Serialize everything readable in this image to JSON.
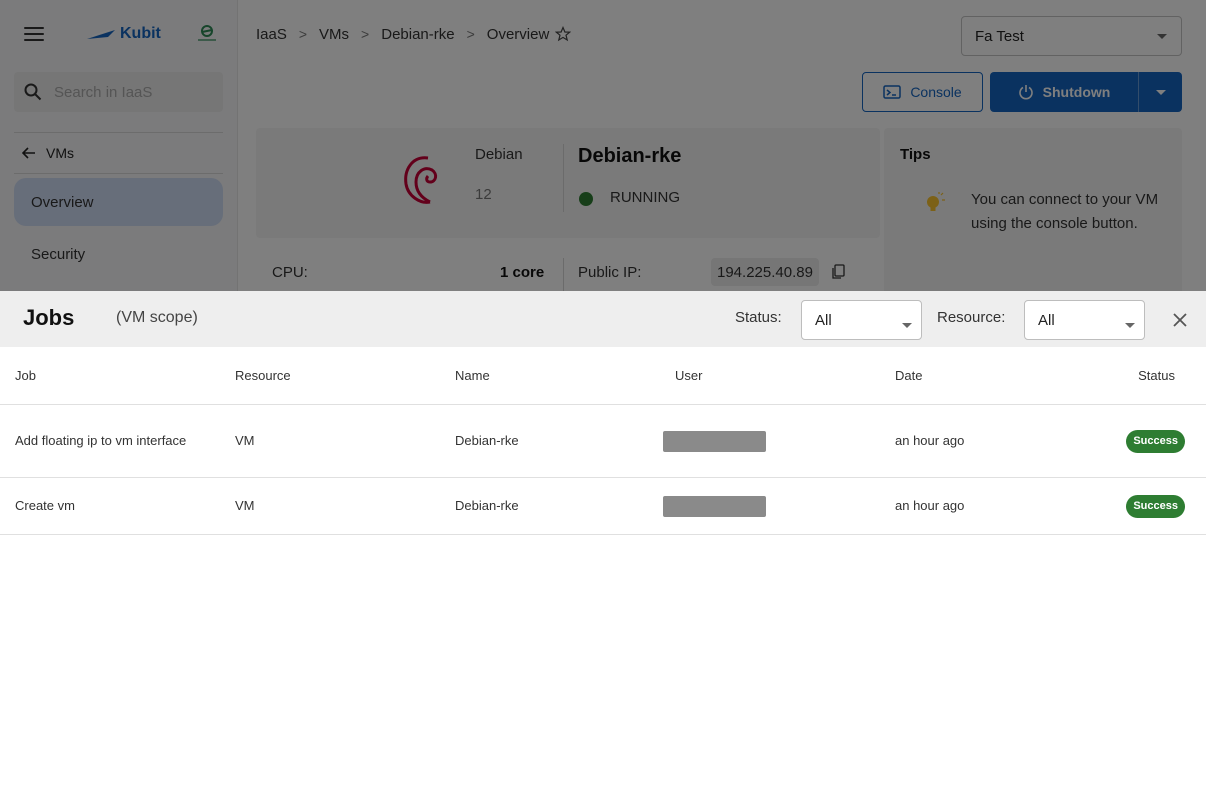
{
  "app": {
    "brand": "Kubit",
    "search_placeholder": "Search in IaaS",
    "back_label": "VMs",
    "nav_items": [
      {
        "label": "Overview",
        "active": true
      },
      {
        "label": "Security",
        "active": false
      }
    ]
  },
  "breadcrumb": [
    "IaaS",
    "VMs",
    "Debian-rke",
    "Overview"
  ],
  "project_select": {
    "value": "Fa Test"
  },
  "actions": {
    "console_label": "Console",
    "shutdown_label": "Shutdown"
  },
  "vm": {
    "os_name": "Debian",
    "os_version": "12",
    "name": "Debian-rke",
    "state": "RUNNING",
    "state_color": "#2e7d32",
    "cpu_label": "CPU:",
    "cpu_value": "1 core",
    "ip_label": "Public IP:",
    "ip_value": "194.225.40.89"
  },
  "tips": {
    "title": "Tips",
    "items": [
      "You can connect to your VM using the console button."
    ]
  },
  "jobs": {
    "title": "Jobs",
    "scope": "(VM scope)",
    "filters": {
      "status_label": "Status:",
      "status_value": "All",
      "resource_label": "Resource:",
      "resource_value": "All"
    },
    "columns": [
      "Job",
      "Resource",
      "Name",
      "User",
      "Date",
      "Status"
    ],
    "rows": [
      {
        "job": "Add floating ip to vm interface",
        "resource": "VM",
        "name": "Debian-rke",
        "user": "",
        "date": "an hour ago",
        "status": "Success"
      },
      {
        "job": "Create vm",
        "resource": "VM",
        "name": "Debian-rke",
        "user": "",
        "date": "an hour ago",
        "status": "Success"
      }
    ],
    "status_color": "#2e7d32"
  },
  "colors": {
    "accent": "#1565c0",
    "success": "#2e7d32",
    "active_nav": "#cfdcf5"
  }
}
